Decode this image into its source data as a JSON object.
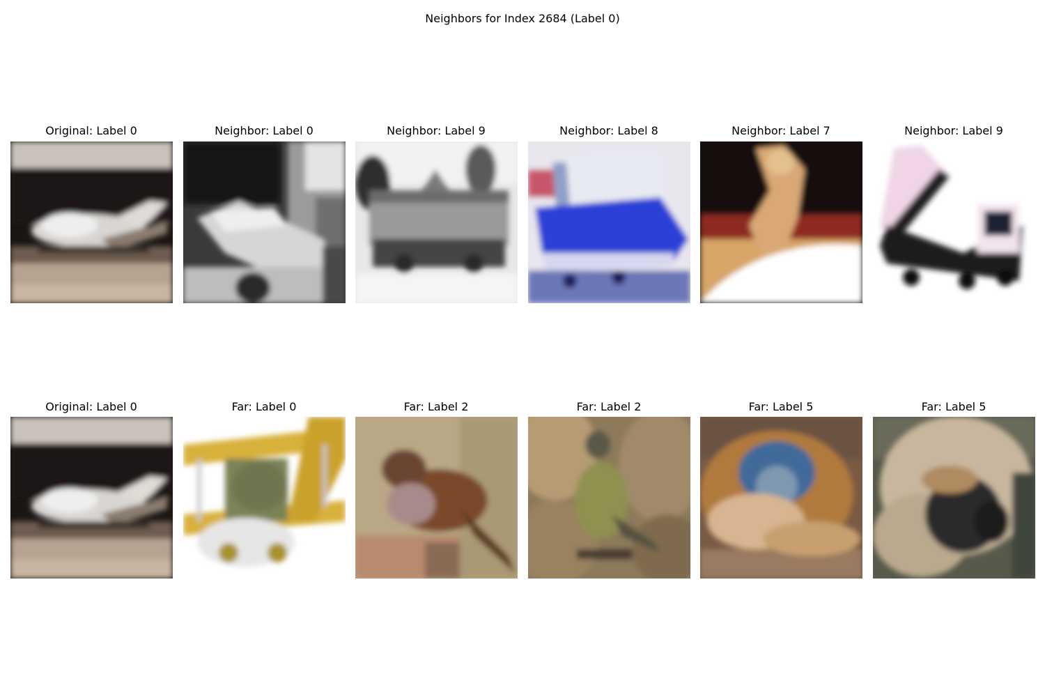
{
  "figure": {
    "title": "Neighbors for Index 2684 (Label 0)"
  },
  "rows": [
    {
      "panels": [
        {
          "title": "Original: Label 0",
          "image": "airplane-in-hangar"
        },
        {
          "title": "Neighbor: Label 0",
          "image": "grayscale-airplane-hangar"
        },
        {
          "title": "Neighbor: Label 9",
          "image": "grayscale-truck"
        },
        {
          "title": "Neighbor: Label 8",
          "image": "blue-boat-on-trailer"
        },
        {
          "title": "Neighbor: Label 7",
          "image": "rearing-horse"
        },
        {
          "title": "Neighbor: Label 9",
          "image": "dump-truck"
        }
      ]
    },
    {
      "panels": [
        {
          "title": "Original: Label 0",
          "image": "airplane-in-hangar"
        },
        {
          "title": "Far: Label 0",
          "image": "yellow-biplane"
        },
        {
          "title": "Far: Label 2",
          "image": "sparrow-on-post"
        },
        {
          "title": "Far: Label 2",
          "image": "finch-on-branch"
        },
        {
          "title": "Far: Label 5",
          "image": "long-haired-monkey-dog"
        },
        {
          "title": "Far: Label 5",
          "image": "shaggy-dog"
        }
      ]
    }
  ]
}
